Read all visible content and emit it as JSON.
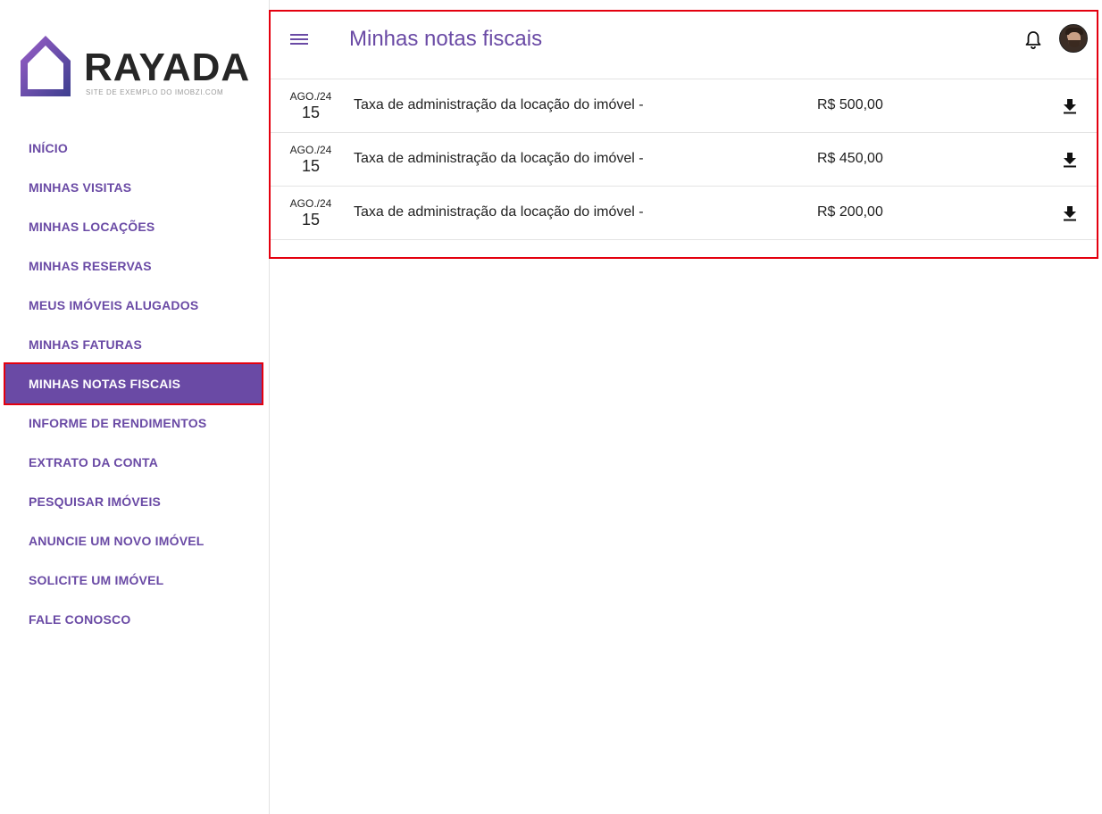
{
  "brand": {
    "name": "RAYADA",
    "tagline": "SITE DE EXEMPLO DO IMOBZI.COM",
    "logo_colors": [
      "#6a4aa5",
      "#9c5fc9",
      "#3d3f8f"
    ]
  },
  "sidebar": {
    "items": [
      {
        "label": "INÍCIO"
      },
      {
        "label": "MINHAS VISITAS"
      },
      {
        "label": "MINHAS LOCAÇÕES"
      },
      {
        "label": "MINHAS RESERVAS"
      },
      {
        "label": "MEUS IMÓVEIS ALUGADOS"
      },
      {
        "label": "MINHAS FATURAS"
      },
      {
        "label": "MINHAS NOTAS FISCAIS",
        "active": true
      },
      {
        "label": "INFORME DE RENDIMENTOS"
      },
      {
        "label": "EXTRATO DA CONTA"
      },
      {
        "label": "PESQUISAR IMÓVEIS"
      },
      {
        "label": "ANUNCIE UM NOVO IMÓVEL"
      },
      {
        "label": "SOLICITE UM IMÓVEL"
      },
      {
        "label": "FALE CONOSCO"
      }
    ]
  },
  "header": {
    "title": "Minhas notas fiscais",
    "menu_icon": "menu-icon",
    "notification_icon": "bell-icon",
    "avatar_icon": "user-avatar"
  },
  "invoices": [
    {
      "month": "AGO./24",
      "day": "15",
      "description": "Taxa de administração da locação do imóvel -",
      "amount": "R$ 500,00",
      "action_icon": "download-icon"
    },
    {
      "month": "AGO./24",
      "day": "15",
      "description": "Taxa de administração da locação do imóvel -",
      "amount": "R$ 450,00",
      "action_icon": "download-icon"
    },
    {
      "month": "AGO./24",
      "day": "15",
      "description": "Taxa de administração da locação do imóvel -",
      "amount": "R$ 200,00",
      "action_icon": "download-icon"
    }
  ],
  "colors": {
    "accent": "#6a4aa5",
    "highlight": "#e4000f",
    "text": "#212121"
  }
}
